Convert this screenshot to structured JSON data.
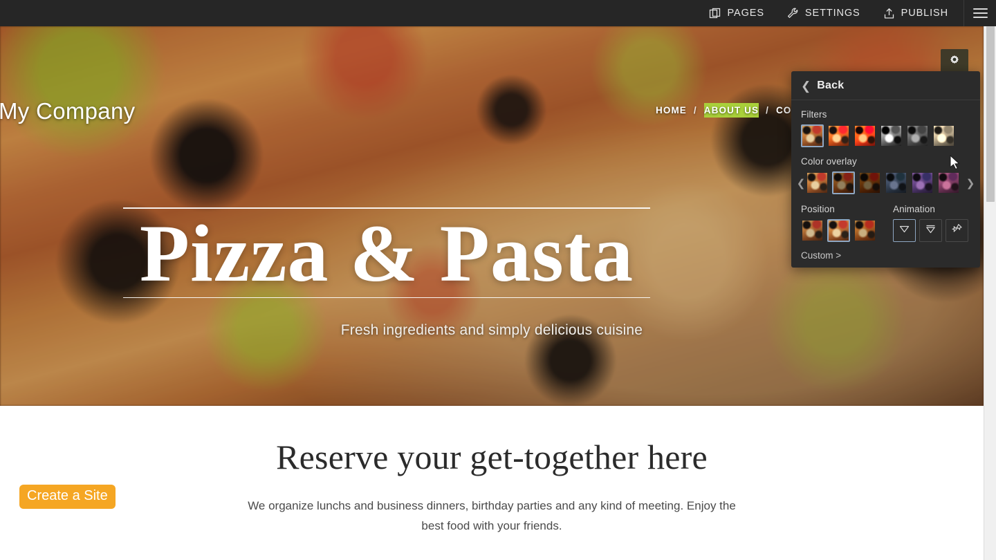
{
  "topbar": {
    "items": [
      {
        "label": "PAGES",
        "icon": "pages-icon"
      },
      {
        "label": "SETTINGS",
        "icon": "wrench-icon"
      },
      {
        "label": "PUBLISH",
        "icon": "upload-icon"
      }
    ],
    "menu_icon": "hamburger-icon",
    "background": "#262626"
  },
  "site": {
    "logo": "My Company",
    "nav": {
      "items": [
        "HOME",
        "ABOUT US",
        "CONTA"
      ],
      "separator": "/",
      "highlighted": "ABOUT US",
      "highlight_color": "#a9d03a"
    },
    "hero": {
      "title": "Pizza & Pasta",
      "subtitle": "Fresh ingredients and simply delicious cuisine",
      "settings_icon": "gear-icon"
    },
    "section": {
      "heading": "Reserve your get-together here",
      "body": "We organize lunchs and business dinners, birthday parties and any kind of meeting. Enjoy the best food with your friends."
    },
    "create_badge": {
      "label": "Create a Site",
      "color": "#f5a623"
    }
  },
  "panel": {
    "back": "Back",
    "back_icon": "chevron-left-icon",
    "filters": {
      "label": "Filters",
      "selected_index": 0,
      "options": [
        "original",
        "warm",
        "orange",
        "grayscale",
        "dark-grayscale",
        "sepia"
      ]
    },
    "color_overlay": {
      "label": "Color overlay",
      "selected_index": 1,
      "options": [
        "none",
        "dark",
        "deep",
        "blue",
        "purple",
        "pink"
      ],
      "prev_icon": "chevron-left-icon",
      "next_icon": "chevron-right-icon"
    },
    "position": {
      "label": "Position",
      "selected_index": 1,
      "options": [
        "top",
        "center",
        "bottom"
      ]
    },
    "animation": {
      "label": "Animation",
      "selected_index": 0,
      "options": [
        "parallax-down-icon",
        "scroll-down-icon",
        "pin-icon"
      ]
    },
    "custom": "Custom >",
    "selection_color": "#8fa8c4",
    "background": "#2b2b2b"
  },
  "scrollbar": {
    "up_icon": "caret-up-icon"
  }
}
